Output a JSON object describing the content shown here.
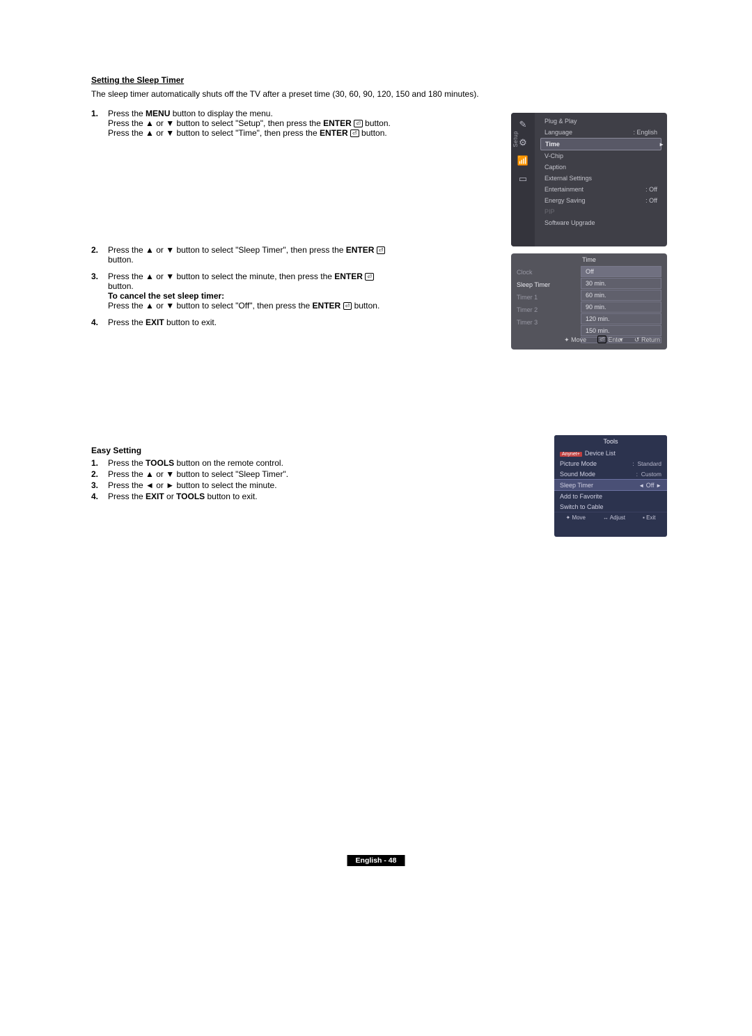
{
  "section1": {
    "title": "Setting the Sleep Timer",
    "intro": "The sleep timer automatically shuts off the TV after a preset time (30, 60, 90, 120, 150 and 180 minutes).",
    "steps": {
      "s1a": "Press the MENU button to display the menu.",
      "s1b_pre": "Press the ▲ or ▼ button to select \"Setup\", then press the ",
      "s1b_enter": "ENTER",
      "s1b_post": " button.",
      "s1c_pre": "Press the ▲ or ▼ button to select \"Time\", then press the ",
      "s1c_enter": "ENTER",
      "s1c_post": " button.",
      "s2_pre": "Press the ▲ or ▼ button to select \"Sleep Timer\", then press the ",
      "s2_enter": "ENTER",
      "s2_post": "button.",
      "s3_pre": "Press the ▲ or ▼ button to select the minute, then press the ",
      "s3_enter": "ENTER",
      "s3_post": "button.",
      "s3_cancel_title": "To cancel the set sleep timer:",
      "s3_cancel_pre": "Press the ▲ or ▼ button to select \"Off\", then press the ",
      "s3_cancel_enter": "ENTER",
      "s3_cancel_post": " button.",
      "s4_pre": "Press the ",
      "s4_exit": "EXIT",
      "s4_post": " button to exit."
    }
  },
  "section2": {
    "title": "Easy Setting",
    "steps": {
      "e1_pre": "Press the ",
      "e1_tools": "TOOLS",
      "e1_post": " button on the remote control.",
      "e2": "Press the ▲ or ▼ button to select \"Sleep Timer\".",
      "e3": "Press the ◄ or ► button to select the minute.",
      "e4_pre": "Press the ",
      "e4_exit": "EXIT",
      "e4_mid": " or ",
      "e4_tools": "TOOLS",
      "e4_post": " button to exit."
    }
  },
  "osd_setup": {
    "tab": "Setup",
    "items": {
      "plug": "Plug & Play",
      "lang": "Language",
      "lang_val": ": English",
      "time": "Time",
      "vchip": "V-Chip",
      "caption": "Caption",
      "ext": "External Settings",
      "ent": "Entertainment",
      "ent_val": ": Off",
      "energy": "Energy Saving",
      "energy_val": ": Off",
      "pip": "PIP",
      "sw": "Software Upgrade"
    }
  },
  "osd_time": {
    "title": "Time",
    "left": {
      "clock": "Clock",
      "sleep": "Sleep Timer",
      "t1": "Timer 1",
      "t2": "Timer 2",
      "t3": "Timer 3"
    },
    "opts": [
      "Off",
      "30 min.",
      "60 min.",
      "90 min.",
      "120 min.",
      "150 min."
    ],
    "foot": {
      "move": "Move",
      "enter": "Enter",
      "return": "Return"
    }
  },
  "osd_tools": {
    "title": "Tools",
    "rows": {
      "dev": "Device List",
      "pic": "Picture Mode",
      "pic_val": "Standard",
      "snd": "Sound Mode",
      "snd_val": "Custom",
      "slp": "Sleep Timer",
      "slp_val": "Off",
      "fav": "Add to Favorite",
      "cab": "Switch to Cable"
    },
    "badge": "Anynet+",
    "foot": {
      "move": "Move",
      "adjust": "Adjust",
      "exit": "Exit"
    }
  },
  "page_footer": "English - 48",
  "icons": {
    "enter": "⏎",
    "return_arrow": "↺",
    "updown": "✦",
    "leftright": "↔",
    "exit_square": "▪"
  }
}
